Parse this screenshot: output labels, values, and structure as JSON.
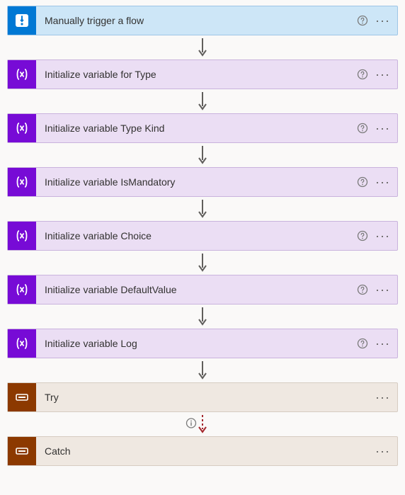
{
  "steps": [
    {
      "kind": "trigger",
      "label": "Manually trigger a flow",
      "hasHelp": true,
      "connector": "solid"
    },
    {
      "kind": "variable",
      "label": "Initialize variable for Type",
      "hasHelp": true,
      "connector": "solid"
    },
    {
      "kind": "variable",
      "label": "Initialize variable Type Kind",
      "hasHelp": true,
      "connector": "solid"
    },
    {
      "kind": "variable",
      "label": "Initialize variable IsMandatory",
      "hasHelp": true,
      "connector": "solid"
    },
    {
      "kind": "variable",
      "label": "Initialize variable Choice",
      "hasHelp": true,
      "connector": "solid"
    },
    {
      "kind": "variable",
      "label": "Initialize variable DefaultValue",
      "hasHelp": true,
      "connector": "solid"
    },
    {
      "kind": "variable",
      "label": "Initialize variable Log",
      "hasHelp": true,
      "connector": "solid"
    },
    {
      "kind": "scope",
      "label": "Try",
      "hasHelp": false,
      "connector": "run-after"
    },
    {
      "kind": "scope",
      "label": "Catch",
      "hasHelp": false,
      "connector": null
    }
  ]
}
